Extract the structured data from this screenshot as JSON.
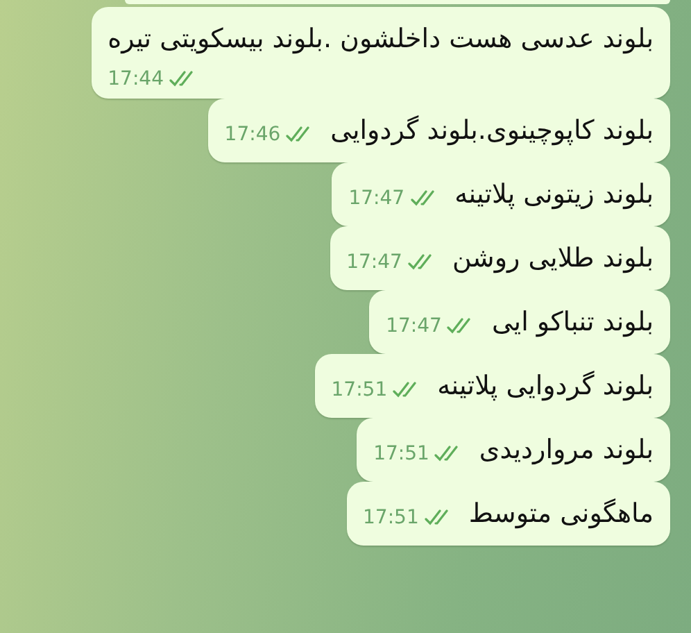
{
  "messages": [
    {
      "kind": "stacked",
      "text": "بلوند عدسی هست داخلشون .بلوند بیسکویتی تیره",
      "time": "17:44",
      "read": true
    },
    {
      "kind": "inline",
      "text": "بلوند کاپوچینوی.بلوند گردوایی",
      "time": "17:46",
      "read": true
    },
    {
      "kind": "inline",
      "text": "بلوند زیتونی پلاتینه",
      "time": "17:47",
      "read": true
    },
    {
      "kind": "inline",
      "text": "بلوند طلایی روشن",
      "time": "17:47",
      "read": true
    },
    {
      "kind": "inline",
      "text": "بلوند تنباکو ایی",
      "time": "17:47",
      "read": true
    },
    {
      "kind": "inline",
      "text": "بلوند گردوایی پلاتینه",
      "time": "17:51",
      "read": true
    },
    {
      "kind": "inline",
      "text": "بلوند مرواردیدی",
      "time": "17:51",
      "read": true
    },
    {
      "kind": "inline",
      "text": "ماهگونی متوسط",
      "time": "17:51",
      "read": true
    }
  ]
}
